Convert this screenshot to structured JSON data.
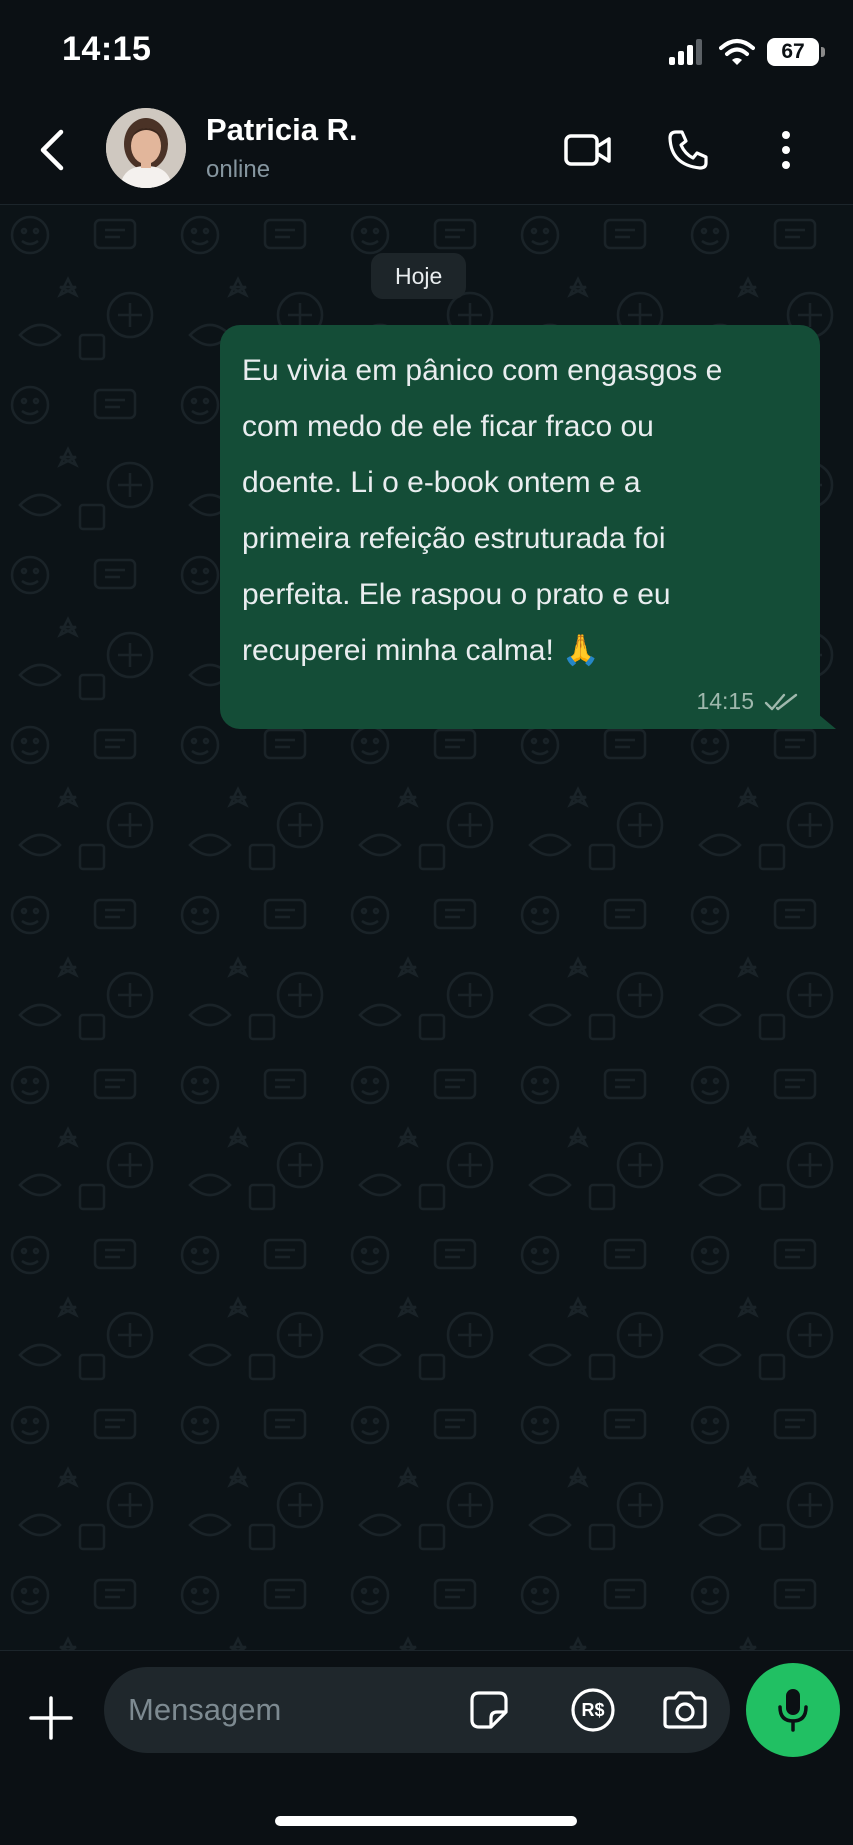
{
  "status_bar": {
    "time": "14:15",
    "battery": "67",
    "icons": [
      "signal-icon",
      "wifi-icon",
      "battery-icon"
    ]
  },
  "header": {
    "contact_name": "Patricia R.",
    "contact_status": "online",
    "icons": [
      "back-arrow-icon",
      "avatar",
      "video-camera-icon",
      "phone-icon",
      "more-vertical-icon"
    ]
  },
  "chat": {
    "date_chip": "Hoje",
    "messages": [
      {
        "direction": "outgoing",
        "text": "Eu vivia em pânico com engasgos e\ncom medo de ele ficar fraco ou\ndoente. Li o e-book ontem e a\nprimeira refeição estruturada foi\nperfeita. Ele raspou o prato e eu\nrecuperei minha calma! 🙏",
        "time": "14:15",
        "status_icon": "double-check-icon"
      }
    ]
  },
  "composer": {
    "placeholder": "Mensagem",
    "pix_label": "R$",
    "icons": [
      "plus-icon",
      "sticker-icon",
      "pix-icon",
      "camera-icon",
      "microphone-icon"
    ]
  },
  "colors": {
    "background": "#0b1014",
    "outgoing_bubble": "#144d37",
    "accent_green": "#21c063",
    "secondary_text": "#8696a0"
  }
}
